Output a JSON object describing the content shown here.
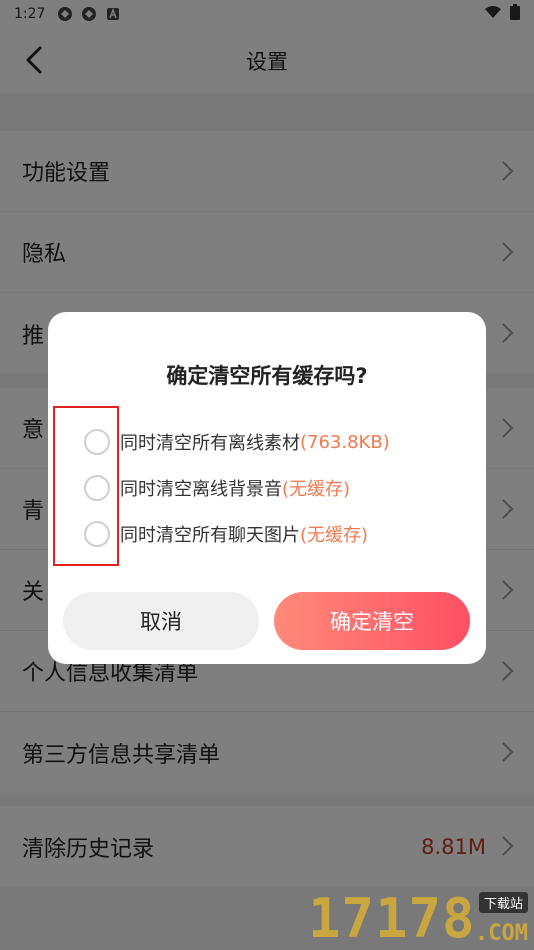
{
  "status_bar": {
    "time": "1:27"
  },
  "header": {
    "title": "设置"
  },
  "groups": [
    {
      "items": [
        {
          "label": "功能设置"
        },
        {
          "label": "隐私"
        },
        {
          "label": "推"
        }
      ]
    },
    {
      "items": [
        {
          "label": "意"
        },
        {
          "label": "青"
        },
        {
          "label": "关"
        },
        {
          "label": "个人信息收集清单"
        },
        {
          "label": "第三方信息共享清单"
        }
      ]
    },
    {
      "items": [
        {
          "label": "清除历史记录",
          "value": "8.81M"
        }
      ]
    }
  ],
  "dialog": {
    "title": "确定清空所有缓存吗?",
    "options": [
      {
        "text": "同时清空所有离线素材",
        "size": "(763.8KB)"
      },
      {
        "text": "同时清空离线背景音",
        "size": "(无缓存)"
      },
      {
        "text": "同时清空所有聊天图片",
        "size": "(无缓存)"
      }
    ],
    "cancel_label": "取消",
    "confirm_label": "确定清空"
  },
  "watermark": {
    "digits": "17178",
    "tag": "下载站",
    "domain": ".COM"
  },
  "colors": {
    "accent": "#ff5a6a",
    "size_text": "#f07a50",
    "value_text": "#c0392b",
    "highlight": "#e02020"
  }
}
